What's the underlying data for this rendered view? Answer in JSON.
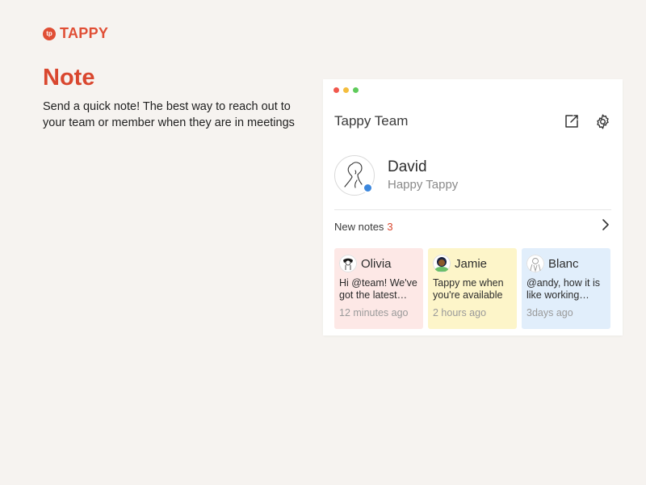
{
  "brand": {
    "name": "TAPPY",
    "logo_glyph": "tp",
    "color": "#e04e35"
  },
  "hero": {
    "title": "Note",
    "description": "Send a quick note! The best way to reach out to your team or member when they are in meetings"
  },
  "window": {
    "traffic_lights": [
      "#f1584d",
      "#f4bd3d",
      "#5fcb5b"
    ],
    "title": "Tappy Team",
    "actions": [
      {
        "icon": "compose-icon"
      },
      {
        "icon": "gear-icon"
      }
    ],
    "profile": {
      "name": "David",
      "status": "Happy Tappy",
      "presence_color": "#3c87dd"
    },
    "new_notes": {
      "label": "New notes",
      "count": "3"
    },
    "notes": [
      {
        "author": "Olivia",
        "text": "Hi @team! We've got the latest…",
        "time": "12 minutes ago",
        "bg": "#fde8e6"
      },
      {
        "author": "Jamie",
        "text": "Tappy me when you're available",
        "time": "2 hours ago",
        "bg": "#fdf5c9"
      },
      {
        "author": "Blanc",
        "text": "@andy, how it is like working…",
        "time": "3days ago",
        "bg": "#e1eefb"
      }
    ]
  }
}
